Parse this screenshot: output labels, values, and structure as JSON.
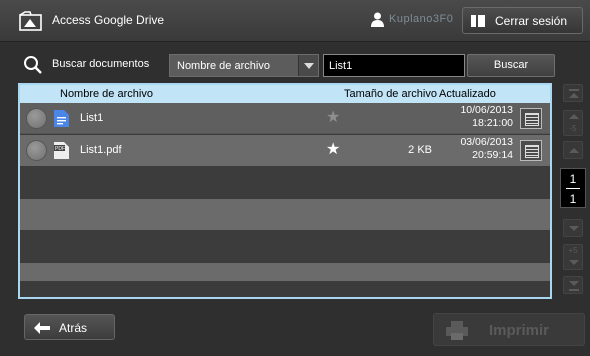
{
  "titlebar": {
    "app_title": "Access Google Drive",
    "user_name": "Kuplano3F0",
    "logout_label": "Cerrar sesión"
  },
  "search": {
    "label": "Buscar documentos",
    "field_selected": "Nombre de archivo",
    "query": "List1",
    "button_label": "Buscar"
  },
  "table": {
    "columns": {
      "name": "Nombre de archivo",
      "size": "Tamaño de archivo",
      "updated": "Actualizado"
    },
    "rows": [
      {
        "name": "List1",
        "type_icon": "google-doc-icon",
        "starred": false,
        "size": "",
        "date": "10/06/2013",
        "time": "18:21:00"
      },
      {
        "name": "List1.pdf",
        "type_icon": "pdf-file-icon",
        "starred": true,
        "size": "2 KB",
        "date": "03/06/2013",
        "time": "20:59:14"
      }
    ]
  },
  "pagination": {
    "current": "1",
    "total": "1",
    "step_up": "-5",
    "step_down": "+5"
  },
  "footer": {
    "back_label": "Atrás",
    "print_label": "Imprimir"
  },
  "colors": {
    "header_bg": "#c1e4f7",
    "panel_border": "#a9d7ef",
    "background": "#2f2f2f"
  }
}
